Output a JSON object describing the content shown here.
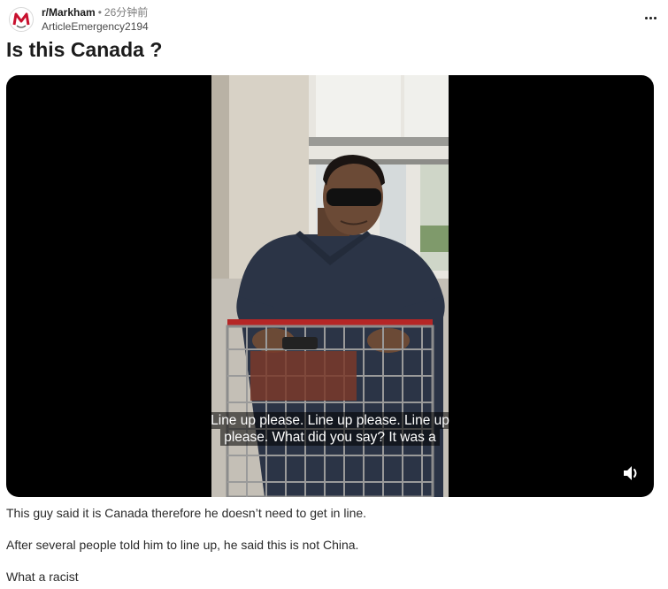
{
  "header": {
    "subreddit": "r/Markham",
    "separator": "•",
    "time": "26分钟前",
    "author": "ArticleEmergency2194"
  },
  "post": {
    "title": "Is this Canada ?",
    "body": [
      "This guy said it is Canada therefore he doesn’t need to get in line.",
      "After several people told him to line up, he said this is not China.",
      "What a racist"
    ]
  },
  "video": {
    "caption_lines": [
      "Line up please. Line up please. Line up",
      "please. What did you say? It was a"
    ],
    "muted": false,
    "volume_icon": "speaker-icon"
  },
  "colors": {
    "avatar_brand": "#c8102e",
    "muted_text": "#7c7c7c",
    "video_bg": "#000000"
  }
}
